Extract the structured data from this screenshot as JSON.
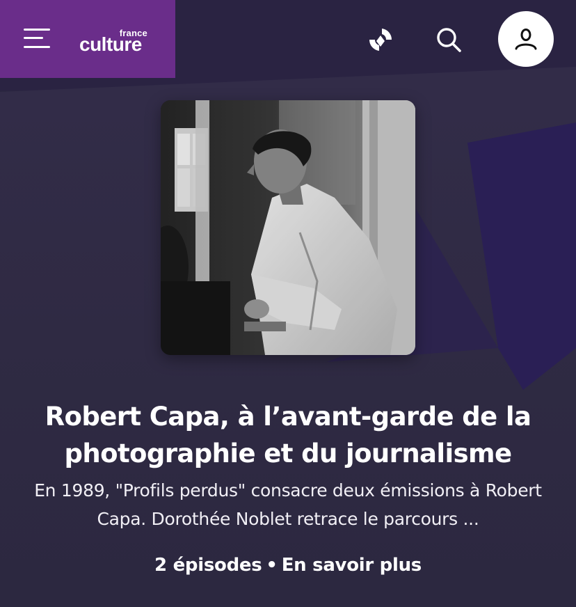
{
  "header": {
    "logo_small": "france",
    "logo_main": "culture",
    "brand_color": "#6a2d8a",
    "icons": [
      "menu-icon",
      "live-radio-icon",
      "search-icon",
      "user-account-icon"
    ]
  },
  "show": {
    "title": "Robert Capa, à l’avant-garde de la photographie et du journalisme",
    "description": "En 1989, \"Profils perdus\" consacre deux émissions à Robert Capa. Dorothée Noblet retrace le parcours ...",
    "episodes": "2 épisodes",
    "separator": "•",
    "more_link": "En savoir plus"
  },
  "colors": {
    "background": "#2f2a43",
    "accent_purple": "#6a2d8a",
    "text": "#ffffff"
  }
}
